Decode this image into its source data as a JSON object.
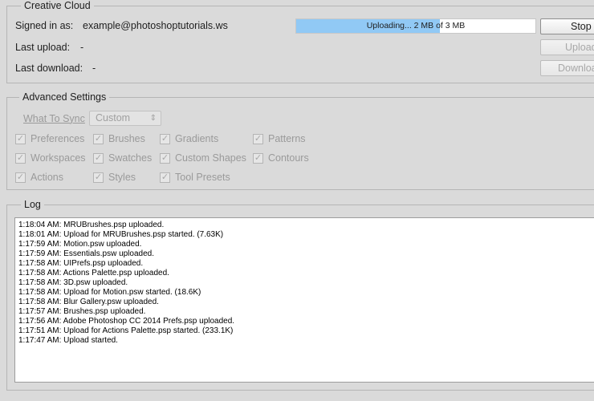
{
  "creative_cloud": {
    "legend": "Creative Cloud",
    "signed_in_label": "Signed in as:",
    "signed_in_value": "example@photoshoptutorials.ws",
    "last_upload_label": "Last upload:",
    "last_upload_value": "-",
    "last_download_label": "Last download:",
    "last_download_value": "-",
    "progress": {
      "text": "Uploading... 2 MB of 3 MB",
      "fraction": 0.6
    },
    "buttons": {
      "stop": "Stop",
      "upload": "Upload",
      "download": "Download"
    }
  },
  "advanced": {
    "legend": "Advanced Settings",
    "what_to_sync_label": "What To Sync",
    "what_to_sync_value": "Custom",
    "checkboxes": {
      "preferences": "Preferences",
      "brushes": "Brushes",
      "gradients": "Gradients",
      "patterns": "Patterns",
      "workspaces": "Workspaces",
      "swatches": "Swatches",
      "custom_shapes": "Custom Shapes",
      "contours": "Contours",
      "actions": "Actions",
      "styles": "Styles",
      "tool_presets": "Tool Presets"
    },
    "checked_mark": "✓"
  },
  "log": {
    "legend": "Log",
    "lines": [
      "1:18:04 AM: MRUBrushes.psp uploaded.",
      "1:18:01 AM: Upload for MRUBrushes.psp started. (7.63K)",
      "1:17:59 AM: Motion.psw uploaded.",
      "1:17:59 AM: Essentials.psw uploaded.",
      "1:17:58 AM: UIPrefs.psp uploaded.",
      "1:17:58 AM: Actions Palette.psp uploaded.",
      "1:17:58 AM: 3D.psw uploaded.",
      "1:17:58 AM: Upload for Motion.psw started. (18.6K)",
      "1:17:58 AM: Blur Gallery.psw uploaded.",
      "1:17:57 AM: Brushes.psp uploaded.",
      "1:17:56 AM: Adobe Photoshop CC 2014 Prefs.psp uploaded.",
      "1:17:51 AM: Upload for Actions Palette.psp started. (233.1K)",
      "1:17:47 AM: Upload started."
    ]
  },
  "colors": {
    "background": "#dadada",
    "progress_fill": "#91c9f5"
  }
}
